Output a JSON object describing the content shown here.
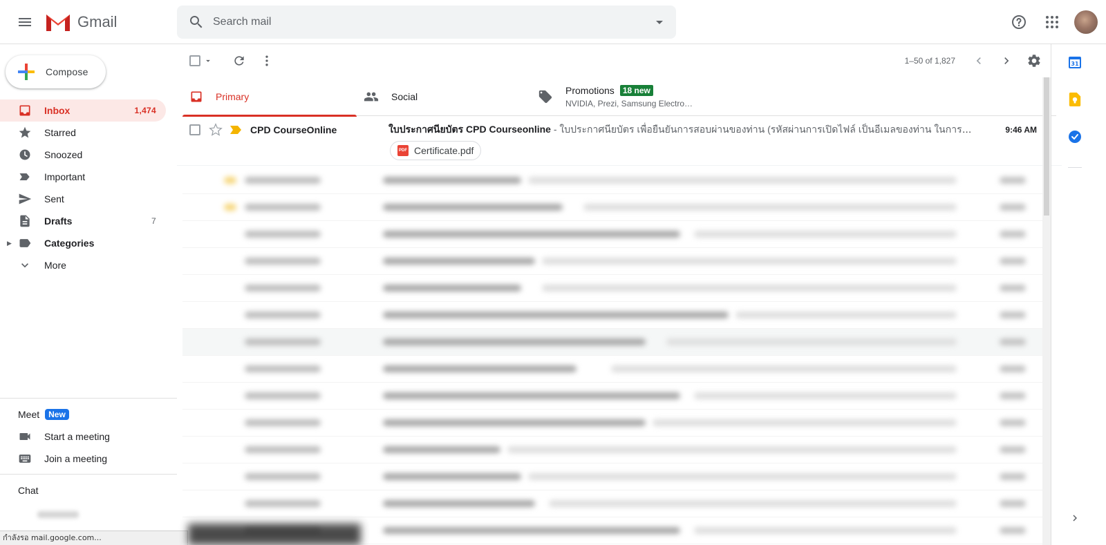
{
  "header": {
    "app_name": "Gmail",
    "search_placeholder": "Search mail"
  },
  "sidebar": {
    "compose_label": "Compose",
    "items": [
      {
        "label": "Inbox",
        "count": "1,474",
        "icon": "inbox-icon"
      },
      {
        "label": "Starred",
        "count": "",
        "icon": "star-icon"
      },
      {
        "label": "Snoozed",
        "count": "",
        "icon": "clock-icon"
      },
      {
        "label": "Important",
        "count": "",
        "icon": "important-icon"
      },
      {
        "label": "Sent",
        "count": "",
        "icon": "send-icon"
      },
      {
        "label": "Drafts",
        "count": "7",
        "icon": "draft-icon"
      },
      {
        "label": "Categories",
        "count": "",
        "icon": "label-icon"
      },
      {
        "label": "More",
        "count": "",
        "icon": "chevron-down-icon"
      }
    ],
    "meet": {
      "title": "Meet",
      "badge": "New",
      "items": [
        {
          "label": "Start a meeting",
          "icon": "video-icon"
        },
        {
          "label": "Join a meeting",
          "icon": "keyboard-icon"
        }
      ]
    },
    "chat_title": "Chat"
  },
  "status_bar": "กำลังรอ mail.google.com...",
  "toolbar": {
    "pagination": "1–50 of 1,827"
  },
  "tabs": [
    {
      "label": "Primary",
      "icon": "inbox-icon"
    },
    {
      "label": "Social",
      "icon": "people-icon"
    },
    {
      "label": "Promotions",
      "badge": "18 new",
      "subtitle": "NVIDIA, Prezi, Samsung Electro…",
      "icon": "tag-icon"
    }
  ],
  "first_email": {
    "sender": "CPD CourseOnline",
    "subject": "ใบประกาศนียบัตร CPD Courseonline",
    "snippet": " - ใบประกาศนียบัตร เพื่อยืนยันการสอบผ่านของท่าน (รหัสผ่านการเปิดไฟล์ เป็นอีเมลของท่าน ในการเข้าดูใบประกาศนียบัตร",
    "time": "9:46 AM",
    "attachment": "Certificate.pdf",
    "attachment_icon_text": "PDF"
  },
  "colors": {
    "accent_red": "#d93025",
    "active_bg": "#fce8e6",
    "promo_badge": "#188038",
    "meet_badge": "#1a73e8"
  }
}
